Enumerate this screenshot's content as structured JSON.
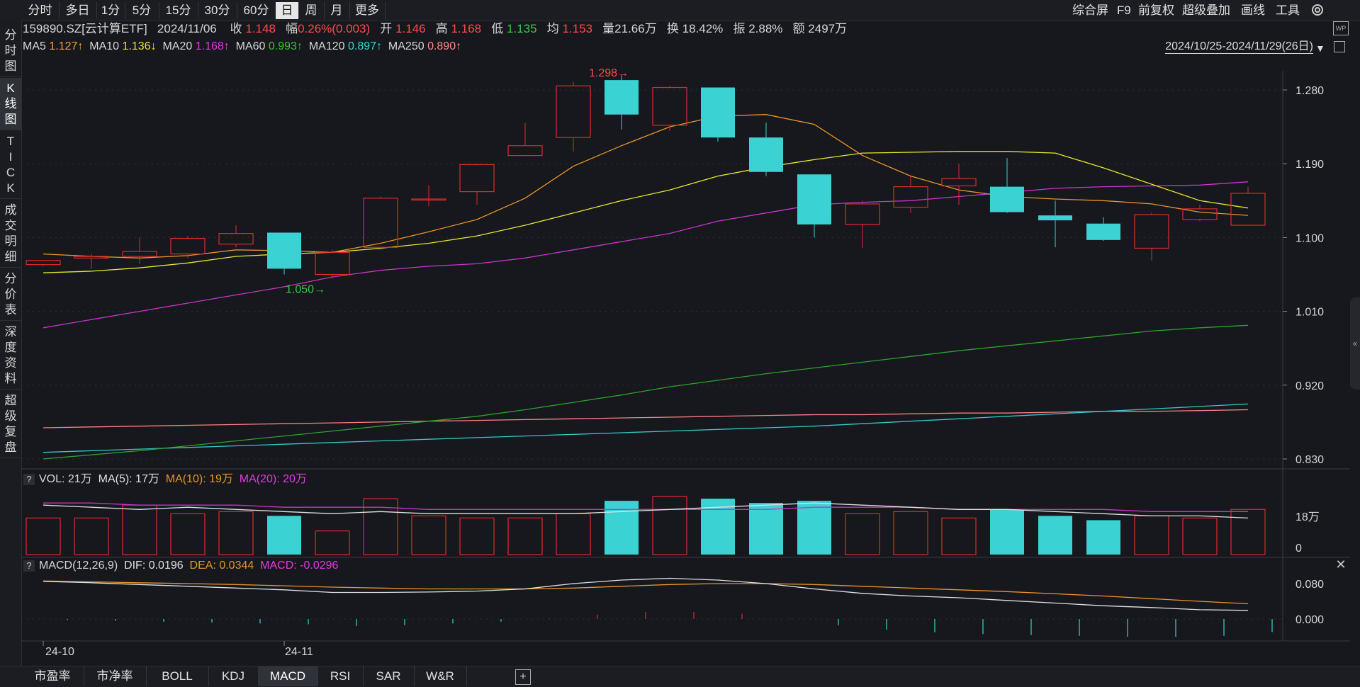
{
  "period_tabs": [
    "分时",
    "多日",
    "1分",
    "5分",
    "15分",
    "30分",
    "60分",
    "日",
    "周",
    "月",
    "更多"
  ],
  "active_period": "日",
  "right_tools": [
    "综合屏",
    "F9",
    "前复权",
    "超级叠加",
    "画线",
    "工具"
  ],
  "sidebar": [
    {
      "label": "分\n时\n图",
      "active": false
    },
    {
      "label": "K\n线\n图",
      "active": true
    },
    {
      "label": "T\nI\nC\nK",
      "active": false
    },
    {
      "label": "成\n交\n明\n细",
      "active": false
    },
    {
      "label": "分\n价\n表",
      "active": false
    },
    {
      "label": "深\n度\n资\n料",
      "active": false
    },
    {
      "label": "超\n级\n复\n盘",
      "active": false
    }
  ],
  "quote": {
    "code_name": "159890.SZ[云计算ETF]",
    "date": "2024/11/06",
    "close_label": "收",
    "close": "1.148",
    "change_label": "幅",
    "change": "0.26%(0.003)",
    "open_label": "开",
    "open": "1.146",
    "high_label": "高",
    "high": "1.168",
    "low_label": "低",
    "low": "1.135",
    "avg_label": "均",
    "avg": "1.153",
    "vol_label": "量",
    "vol": "21.66万",
    "turnover_label": "换",
    "turnover": "18.42%",
    "amplitude_label": "振",
    "amplitude": "2.88%",
    "amount_label": "额",
    "amount": "2497万"
  },
  "ma_legend": [
    {
      "label": "MA5",
      "value": "1.127↑",
      "color": "#f2a23b"
    },
    {
      "label": "MA10",
      "value": "1.136↓",
      "color": "#e6e62e"
    },
    {
      "label": "MA20",
      "value": "1.168↑",
      "color": "#e23be0"
    },
    {
      "label": "MA60",
      "value": "0.993↑",
      "color": "#34c634"
    },
    {
      "label": "MA120",
      "value": "0.897↑",
      "color": "#3ad6d6"
    },
    {
      "label": "MA250",
      "value": "0.890↑",
      "color": "#ff8a8a"
    }
  ],
  "date_range": "2024/10/25-2024/11/29(26日)",
  "colors": {
    "up": "#e02a2a",
    "down": "#3ad2d2",
    "ma5": "#e8952a",
    "ma10": "#e6e62e",
    "ma20": "#c835c8",
    "ma60": "#2ea12e",
    "ma120": "#33c7c7",
    "ma250": "#ff8080"
  },
  "chart_data": {
    "type": "candlestick",
    "y_ticks": [
      "1.280",
      "1.190",
      "1.100",
      "1.010",
      "0.920",
      "0.830"
    ],
    "ylim": [
      0.83,
      1.28
    ],
    "x_labels": [
      "24-10",
      "24-11"
    ],
    "annotations": [
      {
        "text": "1.298",
        "kind": "high"
      },
      {
        "text": "1.050",
        "kind": "low"
      }
    ],
    "candles": [
      {
        "o": 1.067,
        "h": 1.072,
        "l": 1.065,
        "c": 1.072
      },
      {
        "o": 1.075,
        "h": 1.08,
        "l": 1.062,
        "c": 1.077
      },
      {
        "o": 1.077,
        "h": 1.1,
        "l": 1.068,
        "c": 1.083
      },
      {
        "o": 1.08,
        "h": 1.102,
        "l": 1.075,
        "c": 1.099
      },
      {
        "o": 1.092,
        "h": 1.115,
        "l": 1.088,
        "c": 1.105
      },
      {
        "o": 1.106,
        "h": 1.106,
        "l": 1.055,
        "c": 1.062
      },
      {
        "o": 1.055,
        "h": 1.085,
        "l": 1.05,
        "c": 1.082
      },
      {
        "o": 1.088,
        "h": 1.15,
        "l": 1.085,
        "c": 1.148
      },
      {
        "o": 1.147,
        "h": 1.164,
        "l": 1.138,
        "c": 1.147
      },
      {
        "o": 1.156,
        "h": 1.19,
        "l": 1.14,
        "c": 1.189
      },
      {
        "o": 1.2,
        "h": 1.24,
        "l": 1.199,
        "c": 1.212
      },
      {
        "o": 1.222,
        "h": 1.29,
        "l": 1.205,
        "c": 1.285
      },
      {
        "o": 1.292,
        "h": 1.298,
        "l": 1.232,
        "c": 1.25
      },
      {
        "o": 1.237,
        "h": 1.285,
        "l": 1.23,
        "c": 1.283
      },
      {
        "o": 1.283,
        "h": 1.283,
        "l": 1.217,
        "c": 1.222
      },
      {
        "o": 1.222,
        "h": 1.24,
        "l": 1.175,
        "c": 1.18
      },
      {
        "o": 1.177,
        "h": 1.177,
        "l": 1.1,
        "c": 1.116
      },
      {
        "o": 1.116,
        "h": 1.145,
        "l": 1.087,
        "c": 1.141
      },
      {
        "o": 1.137,
        "h": 1.175,
        "l": 1.13,
        "c": 1.162
      },
      {
        "o": 1.163,
        "h": 1.19,
        "l": 1.14,
        "c": 1.172
      },
      {
        "o": 1.162,
        "h": 1.197,
        "l": 1.13,
        "c": 1.131
      },
      {
        "o": 1.127,
        "h": 1.145,
        "l": 1.088,
        "c": 1.121
      },
      {
        "o": 1.117,
        "h": 1.125,
        "l": 1.096,
        "c": 1.097
      },
      {
        "o": 1.087,
        "h": 1.13,
        "l": 1.072,
        "c": 1.128
      },
      {
        "o": 1.122,
        "h": 1.14,
        "l": 1.12,
        "c": 1.135
      },
      {
        "o": 1.115,
        "h": 1.162,
        "l": 1.115,
        "c": 1.154
      }
    ],
    "ma5": [
      1.08,
      1.077,
      1.075,
      1.078,
      1.085,
      1.084,
      1.082,
      1.093,
      1.107,
      1.122,
      1.148,
      1.187,
      1.212,
      1.235,
      1.248,
      1.25,
      1.238,
      1.2,
      1.175,
      1.158,
      1.15,
      1.147,
      1.145,
      1.141,
      1.131,
      1.127
    ],
    "ma10": [
      1.057,
      1.059,
      1.063,
      1.069,
      1.077,
      1.08,
      1.082,
      1.087,
      1.093,
      1.102,
      1.115,
      1.13,
      1.145,
      1.158,
      1.175,
      1.186,
      1.195,
      1.203,
      1.204,
      1.205,
      1.205,
      1.203,
      1.185,
      1.165,
      1.145,
      1.136
    ],
    "ma20": [
      0.99,
      1.0,
      1.01,
      1.02,
      1.03,
      1.04,
      1.052,
      1.06,
      1.065,
      1.068,
      1.075,
      1.085,
      1.095,
      1.105,
      1.12,
      1.13,
      1.14,
      1.143,
      1.145,
      1.15,
      1.155,
      1.16,
      1.162,
      1.163,
      1.164,
      1.168
    ],
    "ma60": [
      0.83,
      0.835,
      0.84,
      0.846,
      0.852,
      0.858,
      0.864,
      0.87,
      0.876,
      0.882,
      0.89,
      0.899,
      0.908,
      0.918,
      0.926,
      0.934,
      0.941,
      0.948,
      0.955,
      0.962,
      0.968,
      0.974,
      0.98,
      0.986,
      0.99,
      0.993
    ],
    "ma120": [
      0.838,
      0.84,
      0.842,
      0.844,
      0.846,
      0.848,
      0.85,
      0.852,
      0.854,
      0.856,
      0.858,
      0.86,
      0.862,
      0.864,
      0.866,
      0.868,
      0.87,
      0.873,
      0.876,
      0.879,
      0.882,
      0.885,
      0.888,
      0.891,
      0.894,
      0.897
    ],
    "ma250": [
      0.868,
      0.869,
      0.87,
      0.871,
      0.872,
      0.873,
      0.874,
      0.875,
      0.876,
      0.877,
      0.878,
      0.879,
      0.88,
      0.881,
      0.882,
      0.883,
      0.884,
      0.884,
      0.885,
      0.886,
      0.886,
      0.887,
      0.888,
      0.888,
      0.889,
      0.89
    ],
    "volume": {
      "title": "VOL: 21万",
      "ma_labels": [
        {
          "text": "MA(5): 17万",
          "color": "#e0e0e0"
        },
        {
          "text": "MA(10): 19万",
          "color": "#e8952a"
        },
        {
          "text": "MA(20): 20万",
          "color": "#e23be0"
        }
      ],
      "y_ticks": [
        "18万",
        "0"
      ],
      "ylim": [
        0,
        29
      ],
      "values": [
        17,
        17,
        23,
        19,
        20,
        18,
        11,
        26,
        18,
        17,
        17,
        19,
        25,
        27,
        26,
        24,
        25,
        19,
        20,
        17,
        21,
        18,
        16,
        18,
        17,
        21
      ],
      "ma5": [
        23,
        22,
        21,
        22,
        21,
        20,
        19,
        20,
        19,
        19,
        19,
        19,
        20,
        21,
        22,
        23,
        24,
        23,
        22,
        21,
        21,
        20,
        19,
        18,
        18,
        17
      ],
      "ma20": [
        24,
        24,
        23,
        23,
        23,
        22,
        22,
        22,
        21,
        21,
        21,
        21,
        21,
        21,
        21,
        21,
        22,
        22,
        22,
        21,
        21,
        21,
        21,
        20,
        20,
        20
      ]
    },
    "macd": {
      "title": "MACD(12,26,9)",
      "dif_label": "DIF: 0.0196",
      "dea_label": "DEA: 0.0344",
      "macd_label": "MACD: -0.0296",
      "y_ticks": [
        "0.080",
        "0.000"
      ],
      "ylim": [
        -0.045,
        0.095
      ],
      "dif": [
        0.085,
        0.082,
        0.078,
        0.074,
        0.07,
        0.066,
        0.06,
        0.06,
        0.061,
        0.063,
        0.068,
        0.08,
        0.088,
        0.092,
        0.088,
        0.08,
        0.068,
        0.058,
        0.052,
        0.048,
        0.042,
        0.036,
        0.03,
        0.026,
        0.021,
        0.0196
      ],
      "dea": [
        0.086,
        0.084,
        0.082,
        0.08,
        0.078,
        0.075,
        0.072,
        0.07,
        0.068,
        0.068,
        0.068,
        0.07,
        0.074,
        0.078,
        0.08,
        0.08,
        0.078,
        0.074,
        0.07,
        0.066,
        0.062,
        0.057,
        0.052,
        0.046,
        0.04,
        0.0344
      ],
      "hist": [
        -0.002,
        -0.004,
        -0.006,
        -0.008,
        -0.01,
        -0.012,
        -0.016,
        -0.014,
        -0.01,
        -0.006,
        0.001,
        0.01,
        0.016,
        0.016,
        0.012,
        0.001,
        -0.014,
        -0.024,
        -0.03,
        -0.034,
        -0.036,
        -0.038,
        -0.04,
        -0.04,
        -0.038,
        -0.0296
      ]
    }
  },
  "bottom_tabs": [
    "市盈率",
    "市净率",
    "BOLL",
    "KDJ",
    "MACD",
    "RSI",
    "SAR",
    "W&R"
  ],
  "active_bottom_tab": "MACD"
}
